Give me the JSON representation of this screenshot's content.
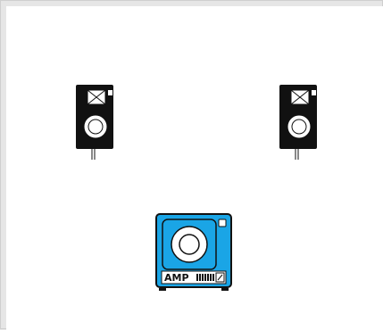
{
  "workspace": {
    "background_color": "#ffffff",
    "frame_color": "#e6e6e6"
  },
  "devices": [
    {
      "name": "speaker-left",
      "icon": "speaker-icon",
      "cabinet_color": "#111111",
      "face_color": "#ffffff"
    },
    {
      "name": "speaker-right",
      "icon": "speaker-icon",
      "cabinet_color": "#111111",
      "face_color": "#ffffff"
    },
    {
      "name": "amp",
      "icon": "amplifier-icon",
      "label": "AMP",
      "body_color": "#1aa5e6",
      "outline_color": "#111111",
      "face_color": "#ffffff"
    }
  ]
}
